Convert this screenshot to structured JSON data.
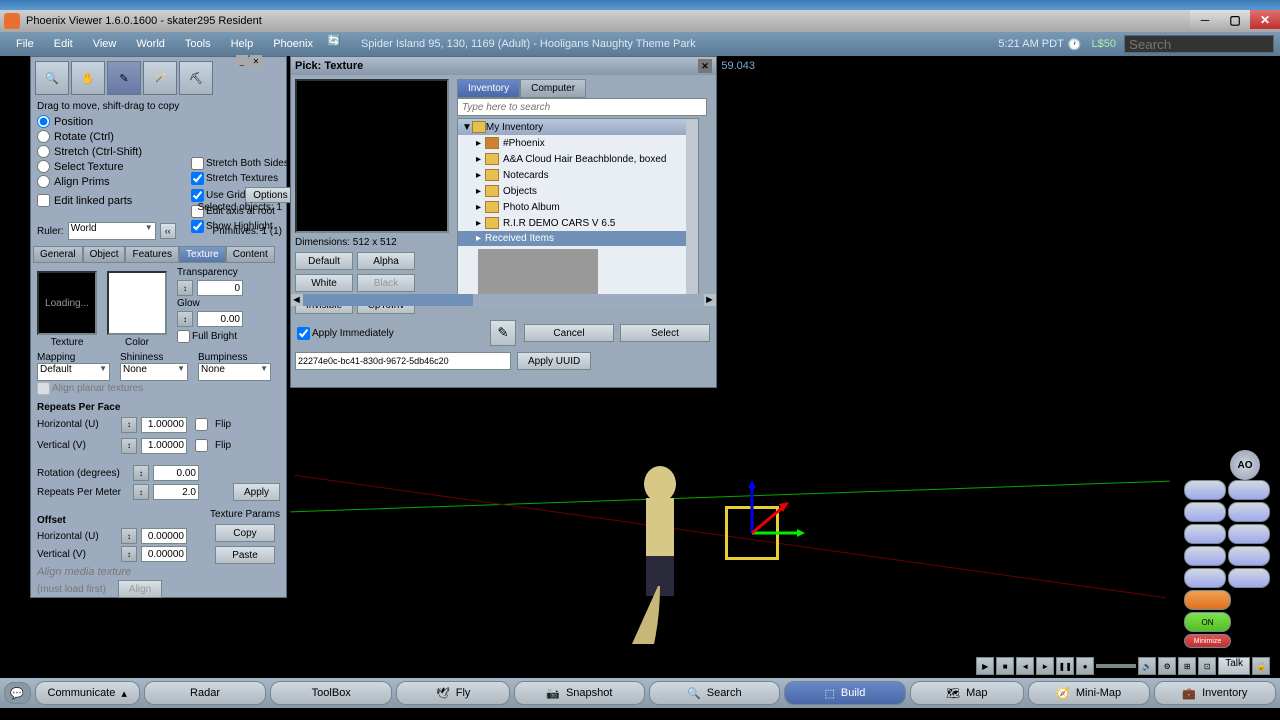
{
  "titlebar": {
    "title": "Phoenix Viewer 1.6.0.1600 - skater295 Resident"
  },
  "menubar": {
    "items": [
      "File",
      "Edit",
      "View",
      "World",
      "Tools",
      "Help",
      "Phoenix"
    ],
    "location": "Spider Island 95, 130, 1169 (Adult) - Hooligans Naughty Theme Park",
    "time": "5:21 AM PDT",
    "balance": "L$50",
    "search_ph": "Search"
  },
  "viewport": {
    "coord": "59.043"
  },
  "build": {
    "hint": "Drag to move, shift-drag to copy",
    "radios": [
      "Position",
      "Rotate (Ctrl)",
      "Stretch (Ctrl-Shift)",
      "Select Texture",
      "Align Prims"
    ],
    "edit_linked": "Edit linked parts",
    "checks": {
      "stretch_both": "Stretch Both Sides",
      "stretch_tex": "Stretch Textures",
      "use_grid": "Use Grid",
      "options": "Options",
      "edit_axis": "Edit axis at root",
      "show_hl": "Show Highlight"
    },
    "sel_objects": "Selected objects: 1",
    "primitives": "Primitives: 1 (1)",
    "ruler_lbl": "Ruler:",
    "ruler_val": "World",
    "tabs": [
      "General",
      "Object",
      "Features",
      "Texture",
      "Content"
    ],
    "texture": {
      "loading": "Loading...",
      "tex_lbl": "Texture",
      "color_lbl": "Color",
      "transp_lbl": "Transparency",
      "transp_val": "0",
      "glow_lbl": "Glow",
      "glow_val": "0.00",
      "full_bright": "Full Bright",
      "mapping_lbl": "Mapping",
      "mapping_val": "Default",
      "shininess_lbl": "Shininess",
      "shininess_val": "None",
      "bumpiness_lbl": "Bumpiness",
      "bumpiness_val": "None",
      "align_planar": "Align planar textures",
      "repeats_lbl": "Repeats Per Face",
      "horiz_lbl": "Horizontal (U)",
      "horiz_val": "1.00000",
      "vert_lbl": "Vertical (V)",
      "vert_val": "1.00000",
      "flip": "Flip",
      "rotation_lbl": "Rotation (degrees)",
      "rotation_val": "0.00",
      "rpm_lbl": "Repeats Per Meter",
      "rpm_val": "2.0",
      "apply": "Apply",
      "offset_lbl": "Offset",
      "off_h_val": "0.00000",
      "off_v_val": "0.00000",
      "tex_params": "Texture Params",
      "copy": "Copy",
      "paste": "Paste",
      "align_media": "Align media texture",
      "must_load": "(must load first)",
      "align_btn": "Align"
    }
  },
  "picker": {
    "title": "Pick: Texture",
    "dims": "Dimensions: 512 x 512",
    "btns": {
      "default": "Default",
      "alpha": "Alpha",
      "white": "White",
      "black": "Black",
      "invisible": "Invisible",
      "cptoinv": "CpToInv"
    },
    "tabs": [
      "Inventory",
      "Computer"
    ],
    "search_ph": "Type here to search",
    "root": "My Inventory",
    "items": [
      "#Phoenix",
      "A&A Cloud Hair Beachblonde, boxed",
      "Notecards",
      "Objects",
      "Photo Album",
      "R.I.R DEMO CARS V 6.5",
      "Received Items"
    ],
    "apply_imm": "Apply Immediately",
    "cancel": "Cancel",
    "select": "Select",
    "uuid": "22274e0c-bc41-830d-9672-5db46c20",
    "apply_uuid": "Apply UUID"
  },
  "bottombar": {
    "communicate": "Communicate",
    "radar": "Radar",
    "toolbox": "ToolBox",
    "fly": "Fly",
    "snapshot": "Snapshot",
    "search": "Search",
    "build": "Build",
    "map": "Map",
    "minimap": "Mini-Map",
    "inventory": "Inventory"
  },
  "media": {
    "talk": "Talk"
  },
  "rbtns": {
    "on": "ON",
    "minimize": "Minimize"
  },
  "ao": "AO"
}
